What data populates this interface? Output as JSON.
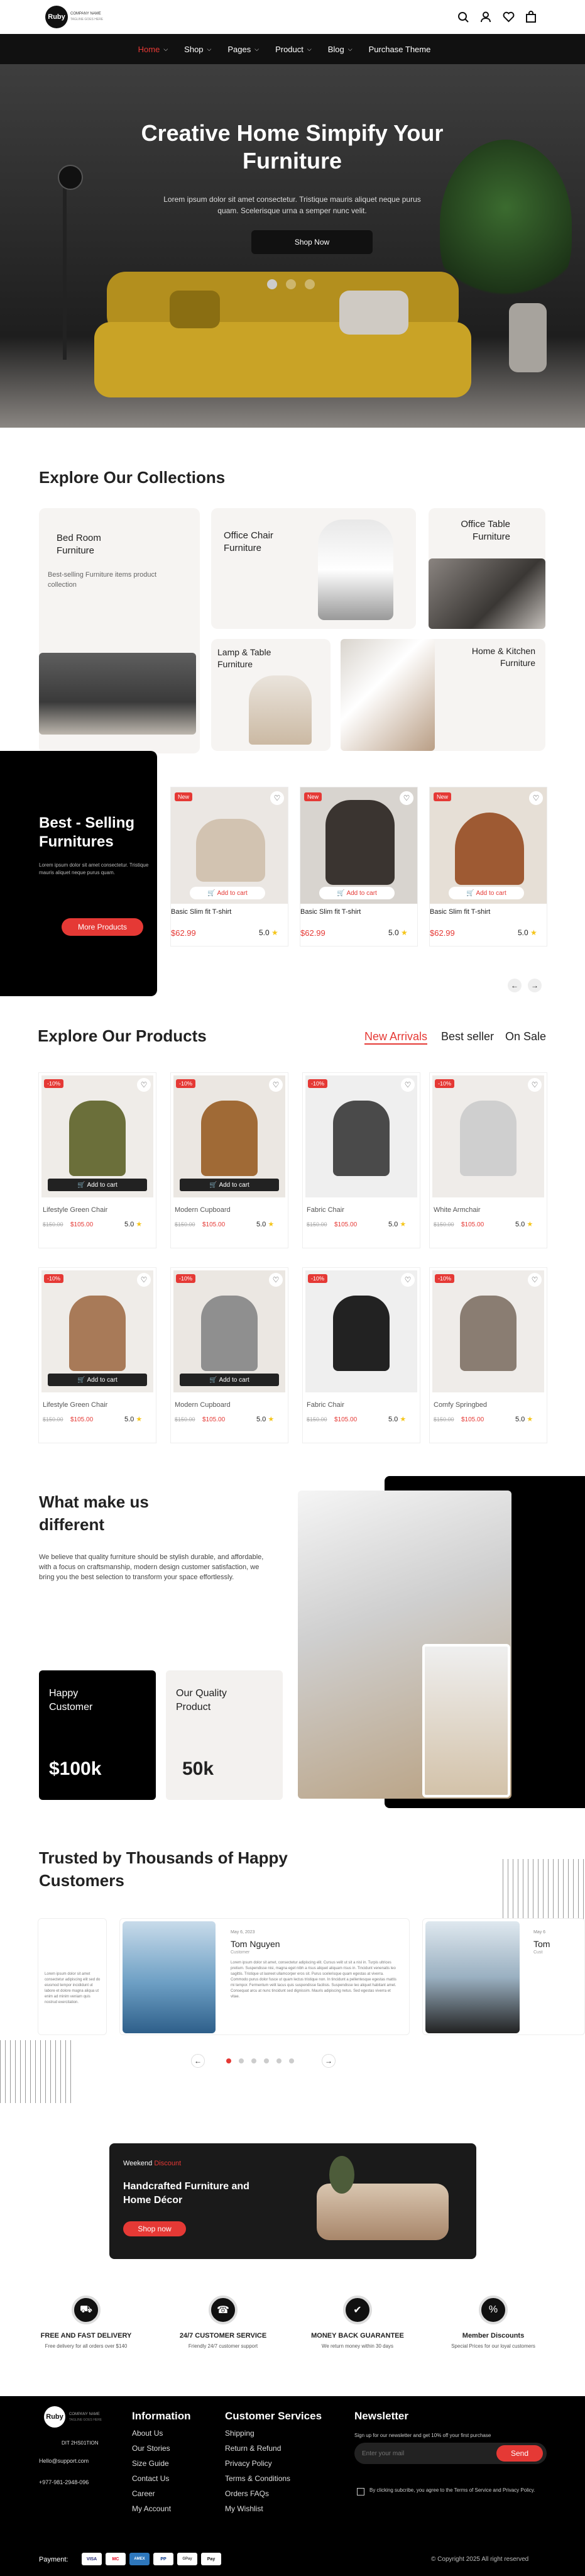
{
  "header": {
    "logo": "Ruby",
    "brand_line1": "COMPANY NAME",
    "brand_line2": "TAGLINE GOES HERE"
  },
  "nav": [
    "Home",
    "Shop",
    "Pages",
    "Product",
    "Blog",
    "Purchase Theme"
  ],
  "hero": {
    "title": "Creative Home Simpify Your Furniture",
    "text": "Lorem ipsum dolor sit amet consectetur. Tristique mauris aliquet neque purus quam. Scelerisque urna a semper nunc velit.",
    "button": "Shop Now"
  },
  "collections": {
    "title": "Explore Our Collections",
    "items": [
      {
        "name": "Bed Room Furniture",
        "desc": "Best-selling Furniture items product collection"
      },
      {
        "name": "Office Chair Furniture"
      },
      {
        "name": "Office Table Furniture"
      },
      {
        "name": "Lamp & Table Furniture"
      },
      {
        "name": "Home & Kitchen Furniture"
      }
    ]
  },
  "bestselling": {
    "title": "Best - Selling Furnitures",
    "text": "Lorem ipsum dolor sit amet consectetur. Tristique mauris aliquet neque purus quam.",
    "button": "More Products",
    "products": [
      {
        "badge": "New",
        "cart": "Add to cart",
        "name": "Basic Slim fit T-shirt",
        "price": "$62.99",
        "rating": "5.0"
      },
      {
        "badge": "New",
        "cart": "Add to cart",
        "name": "Basic Slim fit T-shirt",
        "price": "$62.99",
        "rating": "5.0"
      },
      {
        "badge": "New",
        "cart": "Add to cart",
        "name": "Basic Slim fit T-shirt",
        "price": "$62.99",
        "rating": "5.0"
      }
    ]
  },
  "products": {
    "title": "Explore Our Products",
    "tabs": [
      "New Arrivals",
      "Best seller",
      "On Sale"
    ],
    "items": [
      {
        "badge": "-10%",
        "name": "Lifestyle Green Chair",
        "old": "$150.00",
        "price": "$105.00",
        "rating": "5.0",
        "cart": "Add to cart"
      },
      {
        "badge": "-10%",
        "name": "Modern Cupboard",
        "old": "$150.00",
        "price": "$105.00",
        "rating": "5.0",
        "cart": "Add to cart"
      },
      {
        "badge": "-10%",
        "name": "Fabric Chair",
        "old": "$150.00",
        "price": "$105.00",
        "rating": "5.0"
      },
      {
        "badge": "-10%",
        "name": "White Armchair",
        "old": "$150.00",
        "price": "$105.00",
        "rating": "5.0"
      },
      {
        "badge": "-10%",
        "name": "Lifestyle Green Chair",
        "old": "$150.00",
        "price": "$105.00",
        "rating": "5.0",
        "cart": "Add to cart"
      },
      {
        "badge": "-10%",
        "name": "Modern Cupboard",
        "old": "$150.00",
        "price": "$105.00",
        "rating": "5.0",
        "cart": "Add to cart"
      },
      {
        "badge": "-10%",
        "name": "Fabric Chair",
        "old": "$150.00",
        "price": "$105.00",
        "rating": "5.0"
      },
      {
        "badge": "-10%",
        "name": "Comfy Springbed",
        "old": "$150.00",
        "price": "$105.00",
        "rating": "5.0"
      }
    ]
  },
  "why": {
    "title": "What make us different",
    "text": "We believe that quality furniture should be stylish durable, and affordable, with a focus on craftsmanship, modern design customer satisfaction, we bring you the best selection to transform your space effortlessly.",
    "stat1_label": "Happy Customer",
    "stat1_value": "$100k",
    "stat2_label": "Our Quality Product",
    "stat2_value": "50k"
  },
  "testimonials": {
    "title": "Trusted by Thousands of Happy Customers",
    "left_text": "Lorem ipsum dolor sit amet consectetur adipiscing elit sed do eiusmod tempor incididunt ut labore et dolore magna aliqua ut enim ad minim veniam quis nostrud exercitation.",
    "main": {
      "date": "May 6, 2023",
      "name": "Tom Nguyen",
      "role": "Customer",
      "text": "Lorem ipsum dolor sit amet, consectetur adipiscing elit. Cursus velit ut sit a nisl in. Turpis ultrices pretium. Suspendisse nisi, magna eget nibh a risus aliquet aliquam risus in. Tincidunt venenatis leo sagittis. Tristique ut laoreet ullamcorper eros sit. Purus scelerisque quam egestas at viverra. Commodo purus dolor fusce ut quam lectus tristique non. In tincidunt a pellentesque egestas mattis mi tempor. Fermentum velit lacus quis suspendisse facilisis. Suspendisse leo aliquet habitant amet. Consequat arcu at nunc tincidunt sed dignissim. Mauris adipiscing netus. Sed egestas viverra et vitae."
    },
    "right_date": "May 6",
    "right_name": "Tom",
    "right_role": "Cust"
  },
  "promo": {
    "eyebrow": "Weekend",
    "eyebrow_red": "Discount",
    "title": "Handcrafted Furniture and Home Décor",
    "button": "Shop now"
  },
  "features": [
    {
      "title": "FREE AND FAST DELIVERY",
      "text": "Free delivery for all orders over $140"
    },
    {
      "title": "24/7 CUSTOMER SERVICE",
      "text": "Friendly 24/7 customer support"
    },
    {
      "title": "MONEY BACK GUARANTEE",
      "text": "We return money within 30 days"
    },
    {
      "title": "Member Discounts",
      "text": "Special Prices for our loyal customers"
    }
  ],
  "footer": {
    "logo": "Ruby",
    "brand_line1": "COMPANY NAME",
    "brand_line2": "TAGLINE GOES HERE",
    "address": "DIT 2HS01TION",
    "email": "Hello@support.com",
    "phone": "+977-981-2948-096",
    "info_title": "Information",
    "info_links": [
      "About Us",
      "Our Stories",
      "Size Guide",
      "Contact Us",
      "Career",
      "My Account"
    ],
    "cs_title": "Customer Services",
    "cs_links": [
      "Shipping",
      "Return & Refund",
      "Privacy Policy",
      "Terms & Conditions",
      "Orders FAQs",
      "My Wishlist"
    ],
    "news_title": "Newsletter",
    "news_text": "Sign up for our newsletter and get 10% off your first purchase",
    "email_placeholder": "Enter your mail",
    "send": "Send",
    "consent": "By clicking subcribe, you agree to the Terms of Service and Privacy Policy.",
    "payment_label": "Payment:",
    "payments": [
      "VISA",
      "MC",
      "AMEX",
      "PP",
      "GPay",
      "Pay"
    ],
    "copyright": "Copyright 2025 All right reserved"
  }
}
